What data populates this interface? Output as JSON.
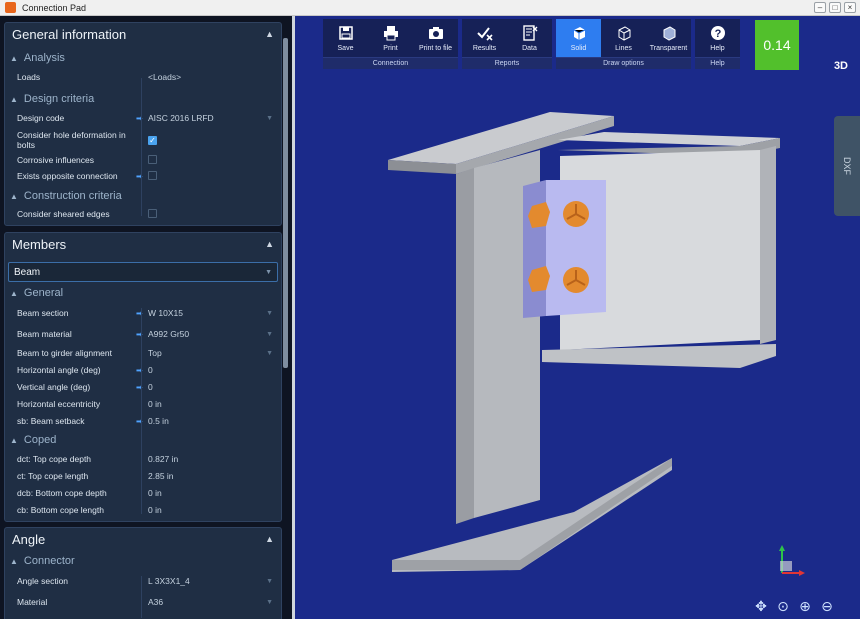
{
  "window": {
    "title": "Connection Pad"
  },
  "general": {
    "title": "General information",
    "analysis_title": "Analysis",
    "loads_label": "Loads",
    "loads_value": "<Loads>",
    "design_title": "Design criteria",
    "design_code_label": "Design code",
    "design_code_value": "AISC 2016 LRFD",
    "hole_label": "Consider hole deformation in bolts",
    "corrosive_label": "Corrosive influences",
    "opposite_label": "Exists opposite connection",
    "construction_title": "Construction criteria",
    "sheared_label": "Consider sheared edges"
  },
  "members": {
    "title": "Members",
    "selected": "Beam",
    "general_title": "General",
    "rows": [
      {
        "label": "Beam section",
        "value": "W 10X15"
      },
      {
        "label": "Beam material",
        "value": "A992 Gr50"
      },
      {
        "label": "Beam to girder alignment",
        "value": "Top"
      },
      {
        "label": "Horizontal angle (deg)",
        "value": "0"
      },
      {
        "label": "Vertical angle (deg)",
        "value": "0"
      },
      {
        "label": "Horizontal eccentricity",
        "value": "0 in"
      },
      {
        "label": "sb: Beam setback",
        "value": "0.5 in"
      }
    ],
    "coped_title": "Coped",
    "coped_rows": [
      {
        "label": "dct: Top cope depth",
        "value": "0.827 in"
      },
      {
        "label": "ct: Top cope length",
        "value": "2.85 in"
      },
      {
        "label": "dcb: Bottom cope depth",
        "value": "0 in"
      },
      {
        "label": "cb: Bottom cope length",
        "value": "0 in"
      }
    ]
  },
  "angle": {
    "title": "Angle",
    "connector_title": "Connector",
    "rows": [
      {
        "label": "Angle section",
        "value": "L 3X3X1_4"
      },
      {
        "label": "Material",
        "value": "A36"
      }
    ]
  },
  "toolbar": {
    "groups": [
      {
        "label": "Connection",
        "buttons": [
          {
            "label": "Save",
            "icon": "save-icon"
          },
          {
            "label": "Print",
            "icon": "print-icon"
          },
          {
            "label": "Print to file",
            "icon": "camera-icon"
          }
        ]
      },
      {
        "label": "Reports",
        "buttons": [
          {
            "label": "Results",
            "icon": "results-icon"
          },
          {
            "label": "Data",
            "icon": "data-icon"
          }
        ]
      },
      {
        "label": "Draw options",
        "buttons": [
          {
            "label": "Solid",
            "icon": "solid-icon"
          },
          {
            "label": "Lines",
            "icon": "lines-icon"
          },
          {
            "label": "Transparent",
            "icon": "transparent-icon"
          }
        ]
      },
      {
        "label": "Help",
        "buttons": [
          {
            "label": "Help",
            "icon": "help-icon"
          }
        ]
      }
    ],
    "score": "0.14"
  },
  "view": {
    "mode": "3D",
    "dxf_tab": "DXF"
  },
  "colors": {
    "viewport_bg": "#1b2a8a",
    "accent": "#2e7df0",
    "score_bg": "#52c02c",
    "steel": "#b9bcc1",
    "plate": "#aeb0ea",
    "bolt": "#e38a2e"
  }
}
